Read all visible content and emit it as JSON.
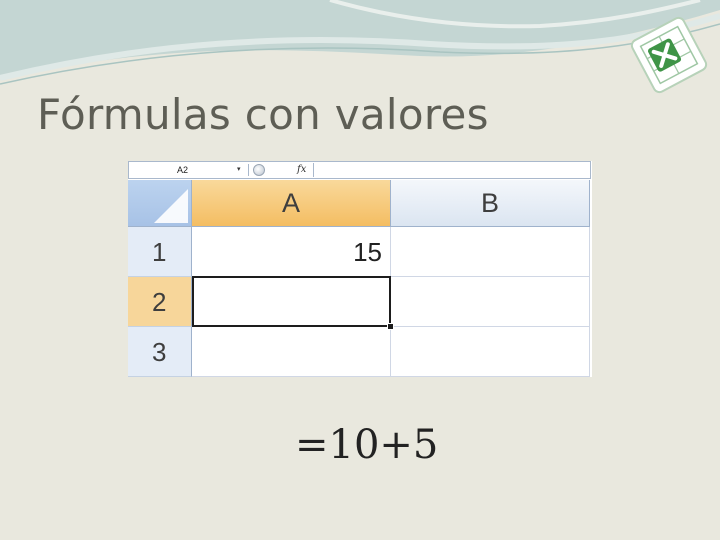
{
  "slide": {
    "title": "Fórmulas con valores",
    "caption": "=10+5"
  },
  "spreadsheet": {
    "name_box": "A2",
    "fx_label": "fx",
    "formula_bar_value": "",
    "columns": [
      "A",
      "B"
    ],
    "rows": [
      {
        "header": "1",
        "cells": [
          "15",
          ""
        ]
      },
      {
        "header": "2",
        "cells": [
          "",
          ""
        ]
      },
      {
        "header": "3",
        "cells": [
          "",
          ""
        ]
      }
    ],
    "active_cell": "A2"
  },
  "icons": {
    "logo": "excel-logo-icon",
    "corner": "select-all-triangle-icon",
    "dropdown": "chevron-down-icon"
  },
  "colors": {
    "background": "#e9e8de",
    "active_header": "#f4bd62",
    "header": "#dbe5f1",
    "logo_green": "#3f9447"
  }
}
